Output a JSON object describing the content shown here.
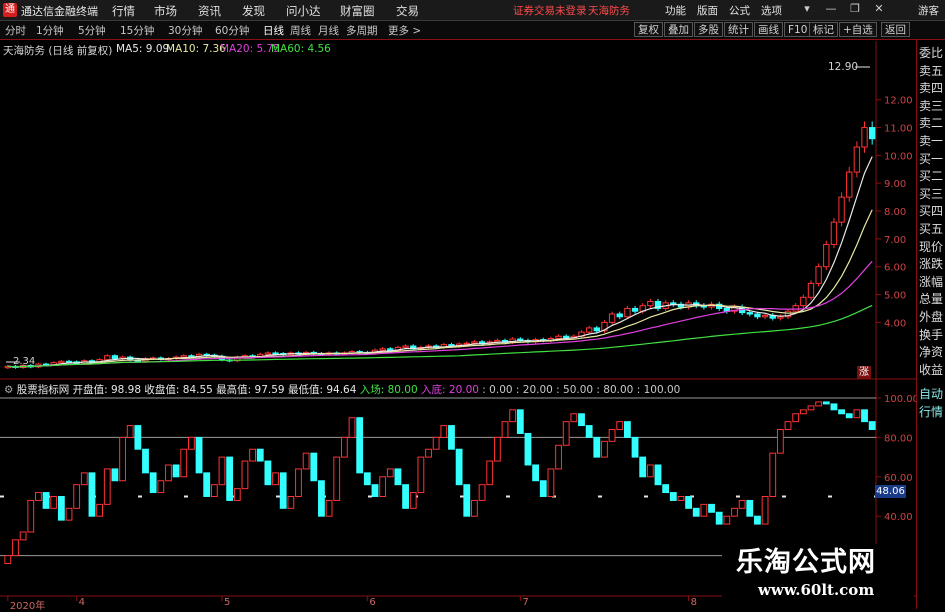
{
  "app": {
    "title": "通达信金融终端",
    "logo_text": "通",
    "menu": [
      "行情",
      "市场",
      "资讯",
      "发现",
      "问小达",
      "财富圈",
      "交易"
    ],
    "login_status": "证券交易未登录",
    "stock_name_header": "天海防务",
    "right_menu": [
      "功能",
      "版面",
      "公式",
      "选项"
    ],
    "guest_label": "游客",
    "window_buttons": [
      "▾",
      "—",
      "❐",
      "✕"
    ]
  },
  "periods": {
    "items": [
      "分时",
      "1分钟",
      "5分钟",
      "15分钟",
      "30分钟",
      "60分钟",
      "日线",
      "周线",
      "月线",
      "多周期",
      "更多 >"
    ],
    "active": "日线"
  },
  "toolbar": {
    "items": [
      "复权",
      "叠加",
      "多股",
      "统计",
      "画线",
      "F10",
      "标记",
      "+自选",
      "返回"
    ]
  },
  "right_panel": {
    "items": [
      "委比",
      "卖五",
      "卖四",
      "卖三",
      "卖二",
      "卖一",
      "买一",
      "买二",
      "买三",
      "买四",
      "买五",
      "现价",
      "涨跌",
      "涨幅",
      "总量",
      "外盘",
      "换手",
      "净资",
      "收益"
    ],
    "lower_items": [
      "自动",
      "行情"
    ]
  },
  "main_panel": {
    "stock_title": "天海防务 (日线 前复权)",
    "legend": [
      {
        "label": "MA5: 9.09",
        "color": "#e8e8e8"
      },
      {
        "label": "MA10: 7.36",
        "color": "#e8e8a0"
      },
      {
        "label": "MA20: 5.75",
        "color": "#e040e0"
      },
      {
        "label": "MA60: 4.56",
        "color": "#40e040"
      }
    ],
    "max_label": "12.90",
    "min_label": "2.34",
    "side_badge": "涨"
  },
  "indicator_panel": {
    "name": "股票指标网",
    "values": [
      {
        "label": "开盘值: 98.98",
        "color": "#e8e8e8"
      },
      {
        "label": "收盘值: 84.55",
        "color": "#e8e8e8"
      },
      {
        "label": "最高值: 97.59",
        "color": "#e8e8e8"
      },
      {
        "label": "最低值: 94.64",
        "color": "#e8e8e8"
      },
      {
        "label": "入场: 80.00",
        "color": "#40e040"
      },
      {
        "label": "入底: 20.00",
        "color": "#e040e0"
      },
      {
        "label": ": 0.00 : 20.00 : 50.00 : 80.00 : 100.00",
        "color": "#c8c8c8"
      }
    ],
    "current_value": "48.06"
  },
  "time_axis": {
    "labels": [
      {
        "text": "2020年",
        "index": 0
      },
      {
        "text": "4",
        "index": 9
      },
      {
        "text": "5",
        "index": 28
      },
      {
        "text": "6",
        "index": 47
      },
      {
        "text": "7",
        "index": 67
      },
      {
        "text": "8",
        "index": 89
      }
    ]
  },
  "watermark": {
    "cn": "乐淘公式网",
    "url": "www.60lt.com"
  },
  "chart_data": [
    {
      "type": "candlestick",
      "title": "天海防务 (日线 前复权)",
      "ylim": [
        2.0,
        13.5
      ],
      "y_ticks": [
        4.0,
        5.0,
        6.0,
        7.0,
        8.0,
        9.0,
        10.0,
        11.0,
        12.0
      ],
      "up_color": "#ff3333",
      "down_color": "#33ffff",
      "opens": [],
      "closes": [
        2.42,
        2.38,
        2.45,
        2.4,
        2.5,
        2.48,
        2.55,
        2.6,
        2.58,
        2.52,
        2.62,
        2.55,
        2.66,
        2.8,
        2.7,
        2.75,
        2.65,
        2.6,
        2.7,
        2.72,
        2.68,
        2.7,
        2.75,
        2.8,
        2.78,
        2.85,
        2.82,
        2.78,
        2.65,
        2.62,
        2.75,
        2.8,
        2.78,
        2.85,
        2.9,
        2.88,
        2.84,
        2.9,
        2.86,
        2.92,
        2.88,
        2.85,
        2.9,
        2.88,
        2.9,
        2.95,
        2.92,
        2.9,
        3.0,
        3.05,
        2.98,
        3.1,
        3.15,
        3.05,
        3.1,
        3.15,
        3.1,
        3.2,
        3.15,
        3.22,
        3.25,
        3.3,
        3.22,
        3.3,
        3.35,
        3.28,
        3.4,
        3.35,
        3.3,
        3.38,
        3.35,
        3.42,
        3.5,
        3.45,
        3.5,
        3.65,
        3.8,
        3.7,
        4.0,
        4.3,
        4.2,
        4.5,
        4.4,
        4.6,
        4.75,
        4.5,
        4.7,
        4.65,
        4.55,
        4.7,
        4.6,
        4.55,
        4.65,
        4.5,
        4.4,
        4.55,
        4.35,
        4.3,
        4.2,
        4.25,
        4.15,
        4.2,
        4.4,
        4.6,
        4.9,
        5.4,
        6.0,
        6.8,
        7.6,
        8.5,
        9.4,
        10.3,
        11.0,
        10.6
      ],
      "ma": [
        {
          "name": "MA5",
          "color": "#e8e8e8",
          "last": 9.09
        },
        {
          "name": "MA10",
          "color": "#e8e8a0",
          "last": 7.36
        },
        {
          "name": "MA20",
          "color": "#e040e0",
          "last": 5.75
        },
        {
          "name": "MA60",
          "color": "#40e040",
          "last": 4.56
        }
      ],
      "max": 12.9,
      "min": 2.34
    },
    {
      "type": "candlestick",
      "title": "股票指标网",
      "ylim": [
        0,
        100
      ],
      "y_ticks": [
        40.0,
        60.0,
        80.0,
        100.0
      ],
      "reference_lines": [
        0,
        20,
        50,
        80,
        100
      ],
      "up_color": "#ff3333",
      "down_color": "#33ffff",
      "closes": [
        20,
        28,
        32,
        48,
        52,
        44,
        50,
        38,
        44,
        56,
        62,
        40,
        46,
        64,
        58,
        80,
        86,
        74,
        62,
        52,
        58,
        66,
        60,
        74,
        80,
        62,
        50,
        56,
        70,
        48,
        54,
        68,
        74,
        68,
        56,
        62,
        44,
        50,
        64,
        72,
        58,
        40,
        48,
        70,
        80,
        90,
        62,
        56,
        50,
        60,
        64,
        56,
        44,
        52,
        70,
        74,
        80,
        86,
        74,
        56,
        40,
        48,
        56,
        68,
        80,
        88,
        94,
        82,
        66,
        58,
        50,
        64,
        76,
        88,
        92,
        86,
        80,
        70,
        78,
        84,
        88,
        80,
        70,
        60,
        66,
        56,
        52,
        48,
        50,
        44,
        40,
        46,
        42,
        36,
        40,
        44,
        48,
        40,
        36,
        50,
        72,
        84,
        88,
        92,
        94,
        96,
        98,
        97,
        94,
        92,
        90,
        94,
        88,
        84
      ],
      "current": 48.06
    }
  ]
}
